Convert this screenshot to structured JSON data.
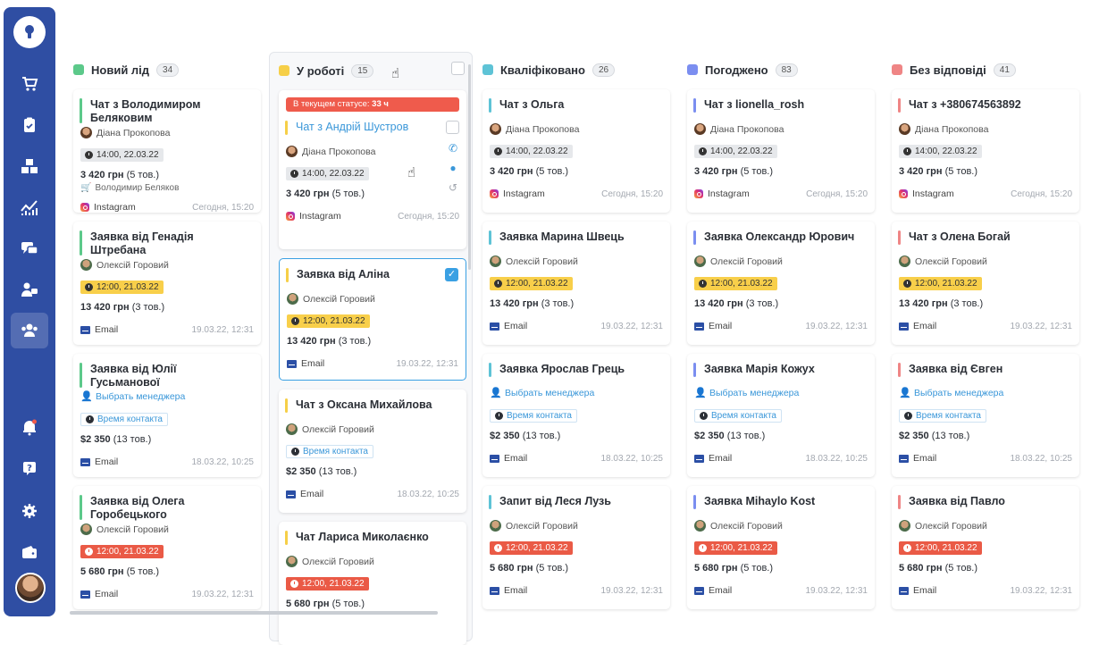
{
  "sidebar": {
    "items": [
      {
        "icon": "cart-icon"
      },
      {
        "icon": "clipboard-check-icon"
      },
      {
        "icon": "boxes-icon"
      },
      {
        "icon": "chart-icon"
      },
      {
        "icon": "chat-icon"
      },
      {
        "icon": "support-agent-icon"
      },
      {
        "icon": "users-icon",
        "active": true
      },
      {
        "icon": "bell-icon"
      },
      {
        "icon": "help-icon"
      },
      {
        "icon": "gear-icon"
      },
      {
        "icon": "wallet-icon"
      }
    ]
  },
  "columns": [
    {
      "name": "Новий лід",
      "count": "34",
      "color": "#5cc98a",
      "cards": [
        {
          "title": "Чат з Володимиром Беляковим",
          "bar": "#5cc98a",
          "manager": "Діана Прокопова",
          "time": "14:00, 22.03.22",
          "time_style": "grey",
          "price": "3 420 грн",
          "qty": "(5 тов.)",
          "client": "Володимир Беляков",
          "source": "Instagram",
          "date": "Сегодня, 15:20"
        },
        {
          "title": "Заявка від Генадія Штребана",
          "bar": "#5cc98a",
          "manager": "Олексій Горовий",
          "time": "12:00, 21.03.22",
          "time_style": "yellow",
          "price": "13 420 грн",
          "qty": "(3 тов.)",
          "source": "Email",
          "date": "19.03.22, 12:31"
        },
        {
          "title": "Заявка від Юлії Гусьманової",
          "bar": "#5cc98a",
          "manager": "Выбрать менеджера",
          "time": "Время контакта",
          "time_style": "link",
          "price": "$2 350",
          "qty": "(13 тов.)",
          "source": "Email",
          "date": "18.03.22, 10:25"
        },
        {
          "title": "Заявка від Олега Горобецького",
          "bar": "#5cc98a",
          "manager": "Олексій Горовий",
          "time": "12:00, 21.03.22",
          "time_style": "red",
          "price": "5 680 грн",
          "qty": "(5 тов.)",
          "source": "Email",
          "date": "19.03.22, 12:31"
        }
      ]
    },
    {
      "name": "У роботі",
      "count": "15",
      "color": "#f6cf48",
      "cards": [
        {
          "title": "Чат з Андрій Шустров",
          "bar": "#f6cf48",
          "status_label": "В текущем статусе:",
          "status_value": "33 ч",
          "manager": "Діана Прокопова",
          "time": "14:00, 22.03.22",
          "time_style": "grey",
          "price": "3 420 грн",
          "qty": "(5 тов.)",
          "source": "Instagram",
          "date": "Сегодня, 15:20"
        },
        {
          "title": "Заявка від Аліна",
          "bar": "#f6cf48",
          "manager": "Олексій Горовий",
          "time": "12:00, 21.03.22",
          "time_style": "yellow",
          "price": "13 420 грн",
          "qty": "(3 тов.)",
          "source": "Email",
          "date": "19.03.22, 12:31"
        },
        {
          "title": "Чат з Оксана Михайлова",
          "bar": "#f6cf48",
          "manager": "Олексій Горовий",
          "time": "Время контакта",
          "time_style": "link",
          "price": "$2 350",
          "qty": "(13 тов.)",
          "source": "Email",
          "date": "18.03.22, 10:25"
        },
        {
          "title": "Чат Лариса Миколаєнко",
          "bar": "#f6cf48",
          "manager": "Олексій Горовий",
          "time": "12:00, 21.03.22",
          "time_style": "red",
          "price": "5 680 грн",
          "qty": "(5 тов.)"
        }
      ]
    },
    {
      "name": "Кваліфіковано",
      "count": "26",
      "color": "#5ec3d6",
      "cards": [
        {
          "title": "Чат з Ольга",
          "bar": "#5ec3d6",
          "manager": "Діана Прокопова",
          "time": "14:00, 22.03.22",
          "time_style": "grey",
          "price": "3 420 грн",
          "qty": "(5 тов.)",
          "source": "Instagram",
          "date": "Сегодня, 15:20"
        },
        {
          "title": "Заявка Марина Швець",
          "bar": "#5ec3d6",
          "manager": "Олексій Горовий",
          "time": "12:00, 21.03.22",
          "time_style": "yellow",
          "price": "13 420 грн",
          "qty": "(3 тов.)",
          "source": "Email",
          "date": "19.03.22, 12:31"
        },
        {
          "title": "Заявка Ярослав Грець",
          "bar": "#5ec3d6",
          "manager": "Выбрать менеджера",
          "time": "Время контакта",
          "time_style": "link",
          "price": "$2 350",
          "qty": "(13 тов.)",
          "source": "Email",
          "date": "18.03.22, 10:25"
        },
        {
          "title": "Запит від Леся Лузь",
          "bar": "#5ec3d6",
          "manager": "Олексій Горовий",
          "time": "12:00, 21.03.22",
          "time_style": "red",
          "price": "5 680 грн",
          "qty": "(5 тов.)",
          "source": "Email",
          "date": "19.03.22, 12:31"
        }
      ]
    },
    {
      "name": "Погоджено",
      "count": "83",
      "color": "#7b8ef0",
      "cards": [
        {
          "title": "Чат з lionella_rosh",
          "bar": "#7b8ef0",
          "manager": "Діана Прокопова",
          "time": "14:00, 22.03.22",
          "time_style": "grey",
          "price": "3 420 грн",
          "qty": "(5 тов.)",
          "source": "Instagram",
          "date": "Сегодня, 15:20"
        },
        {
          "title": "Заявка Олександр Юрович",
          "bar": "#7b8ef0",
          "manager": "Олексій Горовий",
          "time": "12:00, 21.03.22",
          "time_style": "yellow",
          "price": "13 420 грн",
          "qty": "(3 тов.)",
          "source": "Email",
          "date": "19.03.22, 12:31"
        },
        {
          "title": "Заявка Марія Кожух",
          "bar": "#7b8ef0",
          "manager": "Выбрать менеджера",
          "time": "Время контакта",
          "time_style": "link",
          "price": "$2 350",
          "qty": "(13 тов.)",
          "source": "Email",
          "date": "18.03.22, 10:25"
        },
        {
          "title": "Заявка Mihaylo Kost",
          "bar": "#7b8ef0",
          "manager": "Олексій Горовий",
          "time": "12:00, 21.03.22",
          "time_style": "red",
          "price": "5 680 грн",
          "qty": "(5 тов.)",
          "source": "Email",
          "date": "19.03.22, 12:31"
        }
      ]
    },
    {
      "name": "Без відповіді",
      "count": "41",
      "color": "#ef8585",
      "cards": [
        {
          "title": "Чат з +380674563892",
          "bar": "#ef8585",
          "manager": "Діана Прокопова",
          "time": "14:00, 22.03.22",
          "time_style": "grey",
          "price": "3 420 грн",
          "qty": "(5 тов.)",
          "source": "Instagram",
          "date": "Сегодня, 15:20"
        },
        {
          "title": "Чат з Олена Богай",
          "bar": "#ef8585",
          "manager": "Олексій Горовий",
          "time": "12:00, 21.03.22",
          "time_style": "yellow",
          "price": "13 420 грн",
          "qty": "(3 тов.)",
          "source": "Email",
          "date": "19.03.22, 12:31"
        },
        {
          "title": "Заявка від Євген",
          "bar": "#ef8585",
          "manager": "Выбрать менеджера",
          "time": "Время контакта",
          "time_style": "link",
          "price": "$2 350",
          "qty": "(13 тов.)",
          "source": "Email",
          "date": "18.03.22, 10:25"
        },
        {
          "title": "Заявка від Павло",
          "bar": "#ef8585",
          "manager": "Олексій Горовий",
          "time": "12:00, 21.03.22",
          "time_style": "red",
          "price": "5 680 грн",
          "qty": "(5 тов.)",
          "source": "Email",
          "date": "19.03.22, 12:31"
        }
      ]
    }
  ]
}
